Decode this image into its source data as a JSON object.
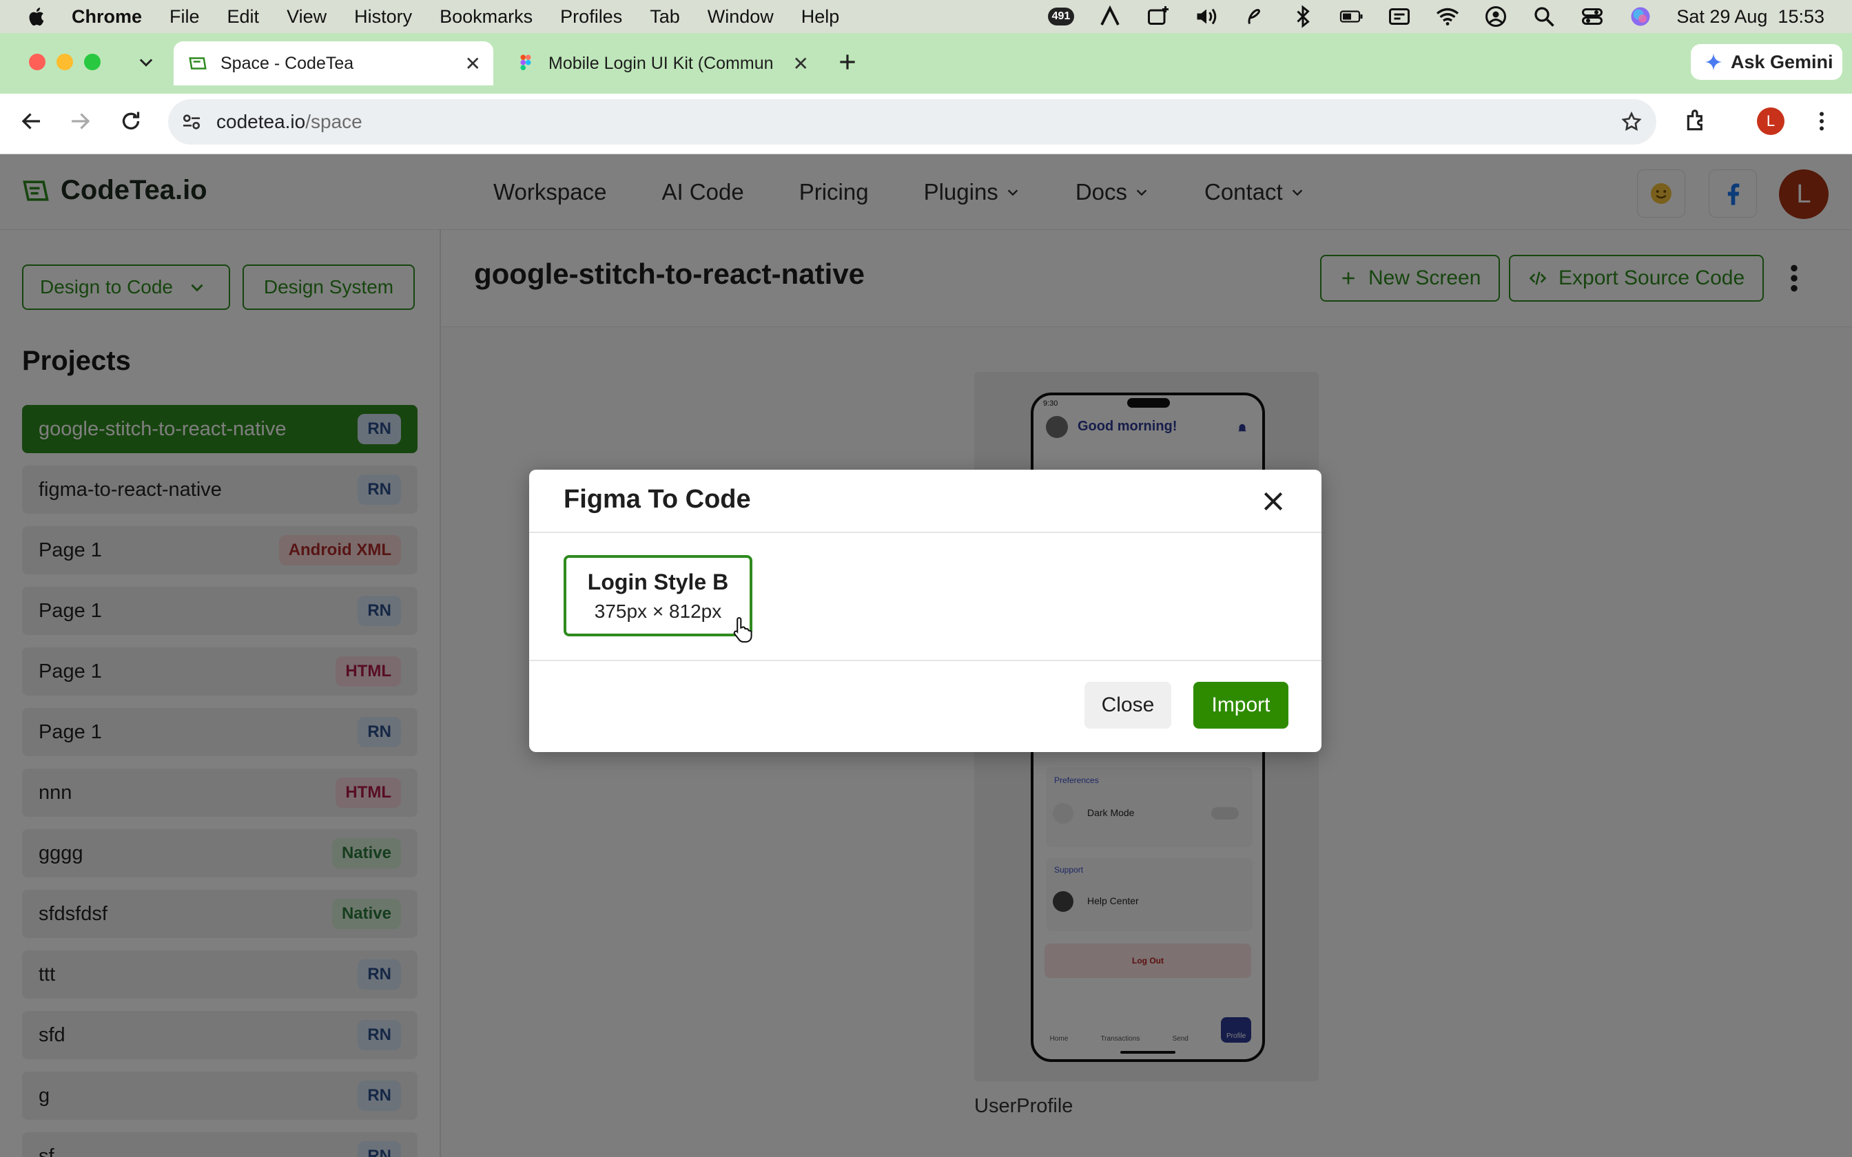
{
  "menubar": {
    "items": [
      "Chrome",
      "File",
      "Edit",
      "View",
      "History",
      "Bookmarks",
      "Profiles",
      "Tab",
      "Window",
      "Help"
    ],
    "notification_count": "491",
    "datetime": "Sat 29 Aug  15:53"
  },
  "browser": {
    "tabs": [
      {
        "title": "Space - CodeTea",
        "active": true
      },
      {
        "title": "Mobile Login UI Kit (Commun",
        "active": false
      }
    ],
    "gemini_label": "Ask Gemini",
    "url_host": "codetea.io",
    "url_path": "/space",
    "profile_initial": "L"
  },
  "site": {
    "logo_text": "CodeTea.io",
    "nav": [
      "Workspace",
      "AI Code",
      "Pricing",
      "Plugins",
      "Docs",
      "Contact"
    ],
    "avatar_initial": "L"
  },
  "sidebar": {
    "design_to_code": "Design to Code",
    "design_system": "Design System",
    "projects_title": "Projects",
    "projects": [
      {
        "name": "google-stitch-to-react-native",
        "tag": "RN",
        "kind": "rn",
        "active": true
      },
      {
        "name": "figma-to-react-native",
        "tag": "RN",
        "kind": "rn"
      },
      {
        "name": "Page 1",
        "tag": "Android XML",
        "kind": "android"
      },
      {
        "name": "Page 1",
        "tag": "RN",
        "kind": "rn"
      },
      {
        "name": "Page 1",
        "tag": "HTML",
        "kind": "html"
      },
      {
        "name": "Page 1",
        "tag": "RN",
        "kind": "rn"
      },
      {
        "name": "nnn",
        "tag": "HTML",
        "kind": "html"
      },
      {
        "name": "gggg",
        "tag": "Native",
        "kind": "native"
      },
      {
        "name": "sfdsfdsf",
        "tag": "Native",
        "kind": "native"
      },
      {
        "name": "ttt",
        "tag": "RN",
        "kind": "rn"
      },
      {
        "name": "sfd",
        "tag": "RN",
        "kind": "rn"
      },
      {
        "name": "g",
        "tag": "RN",
        "kind": "rn"
      },
      {
        "name": "sf",
        "tag": "RN",
        "kind": "rn"
      }
    ]
  },
  "main": {
    "title": "google-stitch-to-react-native",
    "new_screen": "New Screen",
    "export": "Export Source Code",
    "preview_label": "UserProfile",
    "phone": {
      "time": "9:30",
      "greeting": "Good morning!",
      "preferences": "Preferences",
      "dark_mode": "Dark Mode",
      "support": "Support",
      "help_center": "Help Center",
      "log_out": "Log Out",
      "tabs": [
        "Home",
        "Transactions",
        "Send",
        "Profile"
      ]
    }
  },
  "modal": {
    "title": "Figma To Code",
    "frame_name": "Login Style B",
    "frame_size": "375px × 812px",
    "close_label": "Close",
    "import_label": "Import"
  },
  "colors": {
    "brand_green": "#2e8b1e",
    "import_green": "#2e8b00",
    "tab_bar": "#bfe6ba"
  }
}
